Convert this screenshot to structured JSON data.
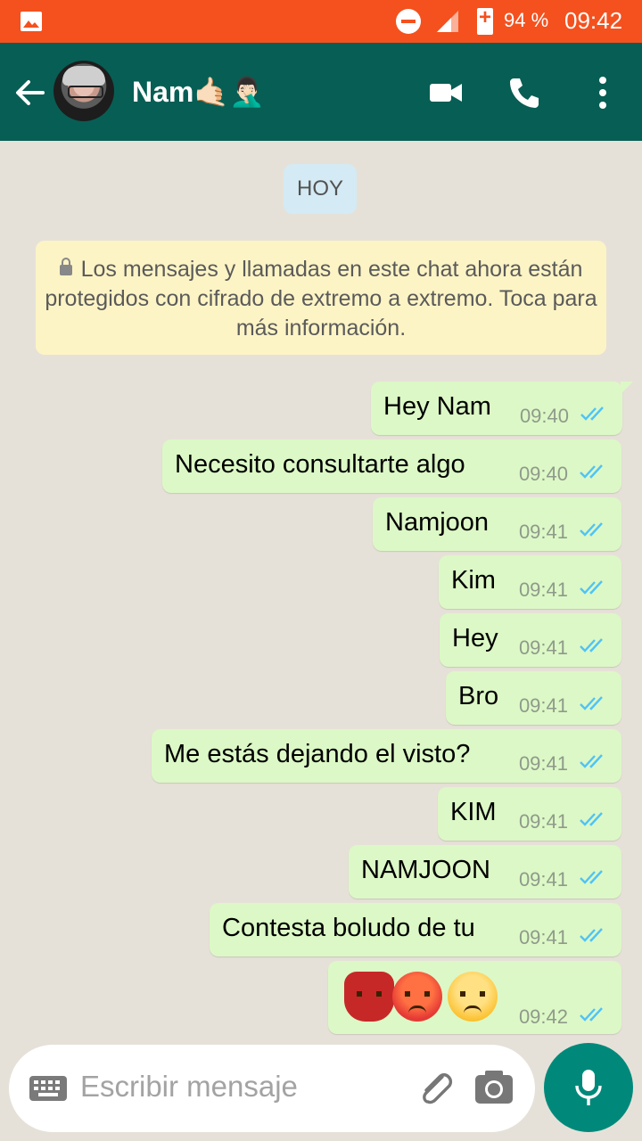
{
  "status_bar": {
    "battery": "94 %",
    "time": "09:42"
  },
  "header": {
    "contact_name": "Nam🤙🏻🤦🏻‍♂️"
  },
  "chat": {
    "date_chip": "HOY",
    "notice": "Los mensajes y llamadas en este chat ahora están protegidos con cifrado de extremo a extremo. Toca para más información.",
    "messages": [
      {
        "text": "Hey Nam",
        "time": "09:40"
      },
      {
        "text": "Necesito consultarte algo",
        "time": "09:40"
      },
      {
        "text": "Namjoon",
        "time": "09:41"
      },
      {
        "text": "Kim",
        "time": "09:41"
      },
      {
        "text": "Hey",
        "time": "09:41"
      },
      {
        "text": "Bro",
        "time": "09:41"
      },
      {
        "text": "Me estás dejando el visto?",
        "time": "09:41"
      },
      {
        "text": "KIM",
        "time": "09:41"
      },
      {
        "text": "NAMJOON",
        "time": "09:41"
      },
      {
        "text": "Contesta boludo de tu",
        "time": "09:41"
      },
      {
        "emojis": [
          "red-mask-emoji",
          "angry-face-emoji",
          "annoyed-face-emoji"
        ],
        "time": "09:42"
      }
    ],
    "read_receipt_color": "#4fc3f7"
  },
  "input": {
    "placeholder": "Escribir mensaje"
  },
  "colors": {
    "header": "#075e54",
    "status_bar": "#f4511e",
    "outgoing_bubble": "#dcf8c6",
    "mic_button": "#00897b"
  }
}
